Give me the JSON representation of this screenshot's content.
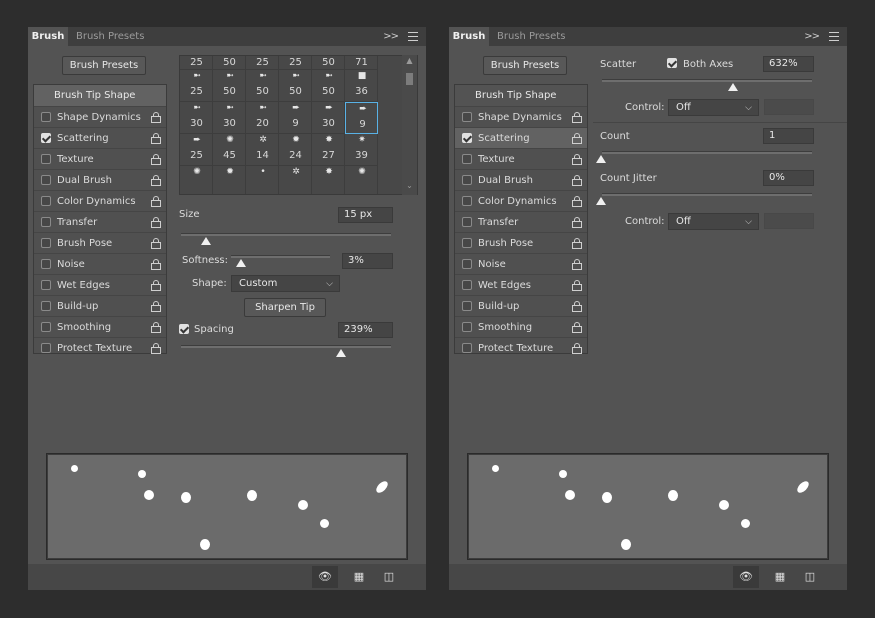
{
  "left_panel": {
    "tabs": {
      "active": "Brush",
      "inactive": "Brush Presets"
    },
    "tab_chevron": ">>",
    "presets_button": "Brush Presets",
    "options_header": "Brush Tip Shape",
    "options": [
      {
        "label": "Shape Dynamics",
        "checked": false,
        "selected": false
      },
      {
        "label": "Scattering",
        "checked": true,
        "selected": false
      },
      {
        "label": "Texture",
        "checked": false,
        "selected": false
      },
      {
        "label": "Dual Brush",
        "checked": false,
        "selected": false
      },
      {
        "label": "Color Dynamics",
        "checked": false,
        "selected": false
      },
      {
        "label": "Transfer",
        "checked": false,
        "selected": false
      },
      {
        "label": "Brush Pose",
        "checked": false,
        "selected": false
      },
      {
        "label": "Noise",
        "checked": false,
        "selected": false
      },
      {
        "label": "Wet Edges",
        "checked": false,
        "selected": false
      },
      {
        "label": "Build-up",
        "checked": false,
        "selected": false
      },
      {
        "label": "Smoothing",
        "checked": false,
        "selected": false
      },
      {
        "label": "Protect Texture",
        "checked": false,
        "selected": false
      }
    ],
    "brush_grid": [
      [
        "25",
        "50",
        "25",
        "25",
        "50",
        "71"
      ],
      [
        "25",
        "50",
        "50",
        "50",
        "50",
        "36"
      ],
      [
        "30",
        "30",
        "20",
        "9",
        "30",
        "9"
      ],
      [
        "25",
        "45",
        "14",
        "24",
        "27",
        "39"
      ]
    ],
    "size_label": "Size",
    "size_value": "15 px",
    "softness_label": "Softness:",
    "softness_value": "3%",
    "shape_label": "Shape:",
    "shape_value": "Custom",
    "sharpen_button": "Sharpen Tip",
    "spacing_label": "Spacing",
    "spacing_value": "239%"
  },
  "right_panel": {
    "tabs": {
      "active": "Brush",
      "inactive": "Brush Presets"
    },
    "tab_chevron": ">>",
    "presets_button": "Brush Presets",
    "options_header": "Brush Tip Shape",
    "options": [
      {
        "label": "Shape Dynamics",
        "checked": false,
        "selected": false
      },
      {
        "label": "Scattering",
        "checked": true,
        "selected": true
      },
      {
        "label": "Texture",
        "checked": false,
        "selected": false
      },
      {
        "label": "Dual Brush",
        "checked": false,
        "selected": false
      },
      {
        "label": "Color Dynamics",
        "checked": false,
        "selected": false
      },
      {
        "label": "Transfer",
        "checked": false,
        "selected": false
      },
      {
        "label": "Brush Pose",
        "checked": false,
        "selected": false
      },
      {
        "label": "Noise",
        "checked": false,
        "selected": false
      },
      {
        "label": "Wet Edges",
        "checked": false,
        "selected": false
      },
      {
        "label": "Build-up",
        "checked": false,
        "selected": false
      },
      {
        "label": "Smoothing",
        "checked": false,
        "selected": false
      },
      {
        "label": "Protect Texture",
        "checked": false,
        "selected": false
      }
    ],
    "scatter_label": "Scatter",
    "both_axes_label": "Both Axes",
    "scatter_value": "632%",
    "control_label": "Control:",
    "control_value": "Off",
    "count_label": "Count",
    "count_value": "1",
    "count_jitter_label": "Count Jitter",
    "count_jitter_value": "0%",
    "control2_label": "Control:",
    "control2_value": "Off"
  },
  "colors": {
    "background": "#2d2d2d",
    "panel": "#535353",
    "selection_border": "#59b2e6"
  }
}
